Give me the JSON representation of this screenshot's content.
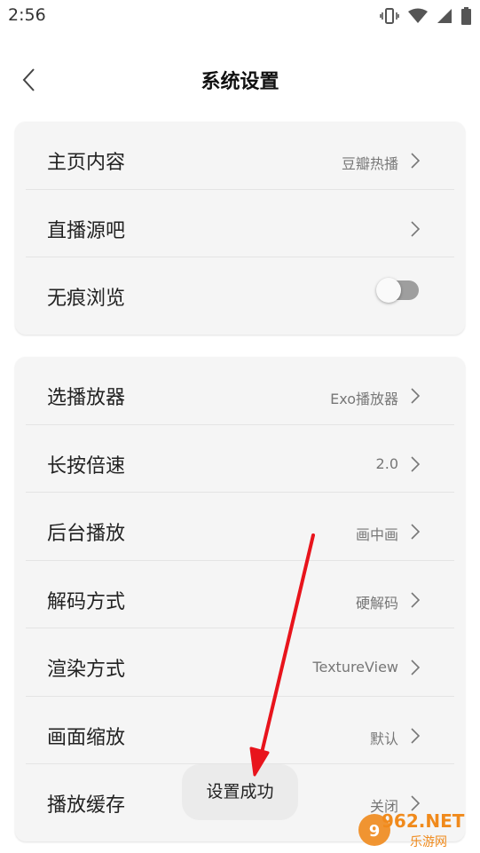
{
  "status_bar": {
    "time": "2:56",
    "icons": [
      "vibrate-icon",
      "wifi-icon",
      "signal-icon",
      "battery-icon"
    ]
  },
  "header": {
    "back_icon": "chevron-left-icon",
    "title": "系统设置"
  },
  "group_1": {
    "items": [
      {
        "label": "主页内容",
        "value": "豆瓣热播"
      },
      {
        "label": "直播源吧",
        "value": ""
      },
      {
        "label": "无痕浏览",
        "toggle_on": false
      }
    ]
  },
  "group_2": {
    "items": [
      {
        "label": "选播放器",
        "value": "Exo播放器"
      },
      {
        "label": "长按倍速",
        "value": "2.0"
      },
      {
        "label": "后台播放",
        "value": "画中画"
      },
      {
        "label": "解码方式",
        "value": "硬解码"
      },
      {
        "label": "渲染方式",
        "value": "TextureView"
      },
      {
        "label": "画面缩放",
        "value": "默认"
      },
      {
        "label": "播放缓存",
        "value": "关闭"
      }
    ]
  },
  "toast": {
    "message": "设置成功"
  },
  "watermark": {
    "brand": "962.NET",
    "sub": "乐游网"
  },
  "colors": {
    "card_bg": "#f5f5f5",
    "divider": "#e4e4e4",
    "toggle_off": "#9e9e9e",
    "annotation_arrow": "#e8141c",
    "watermark_orange": "#f08a1c"
  }
}
